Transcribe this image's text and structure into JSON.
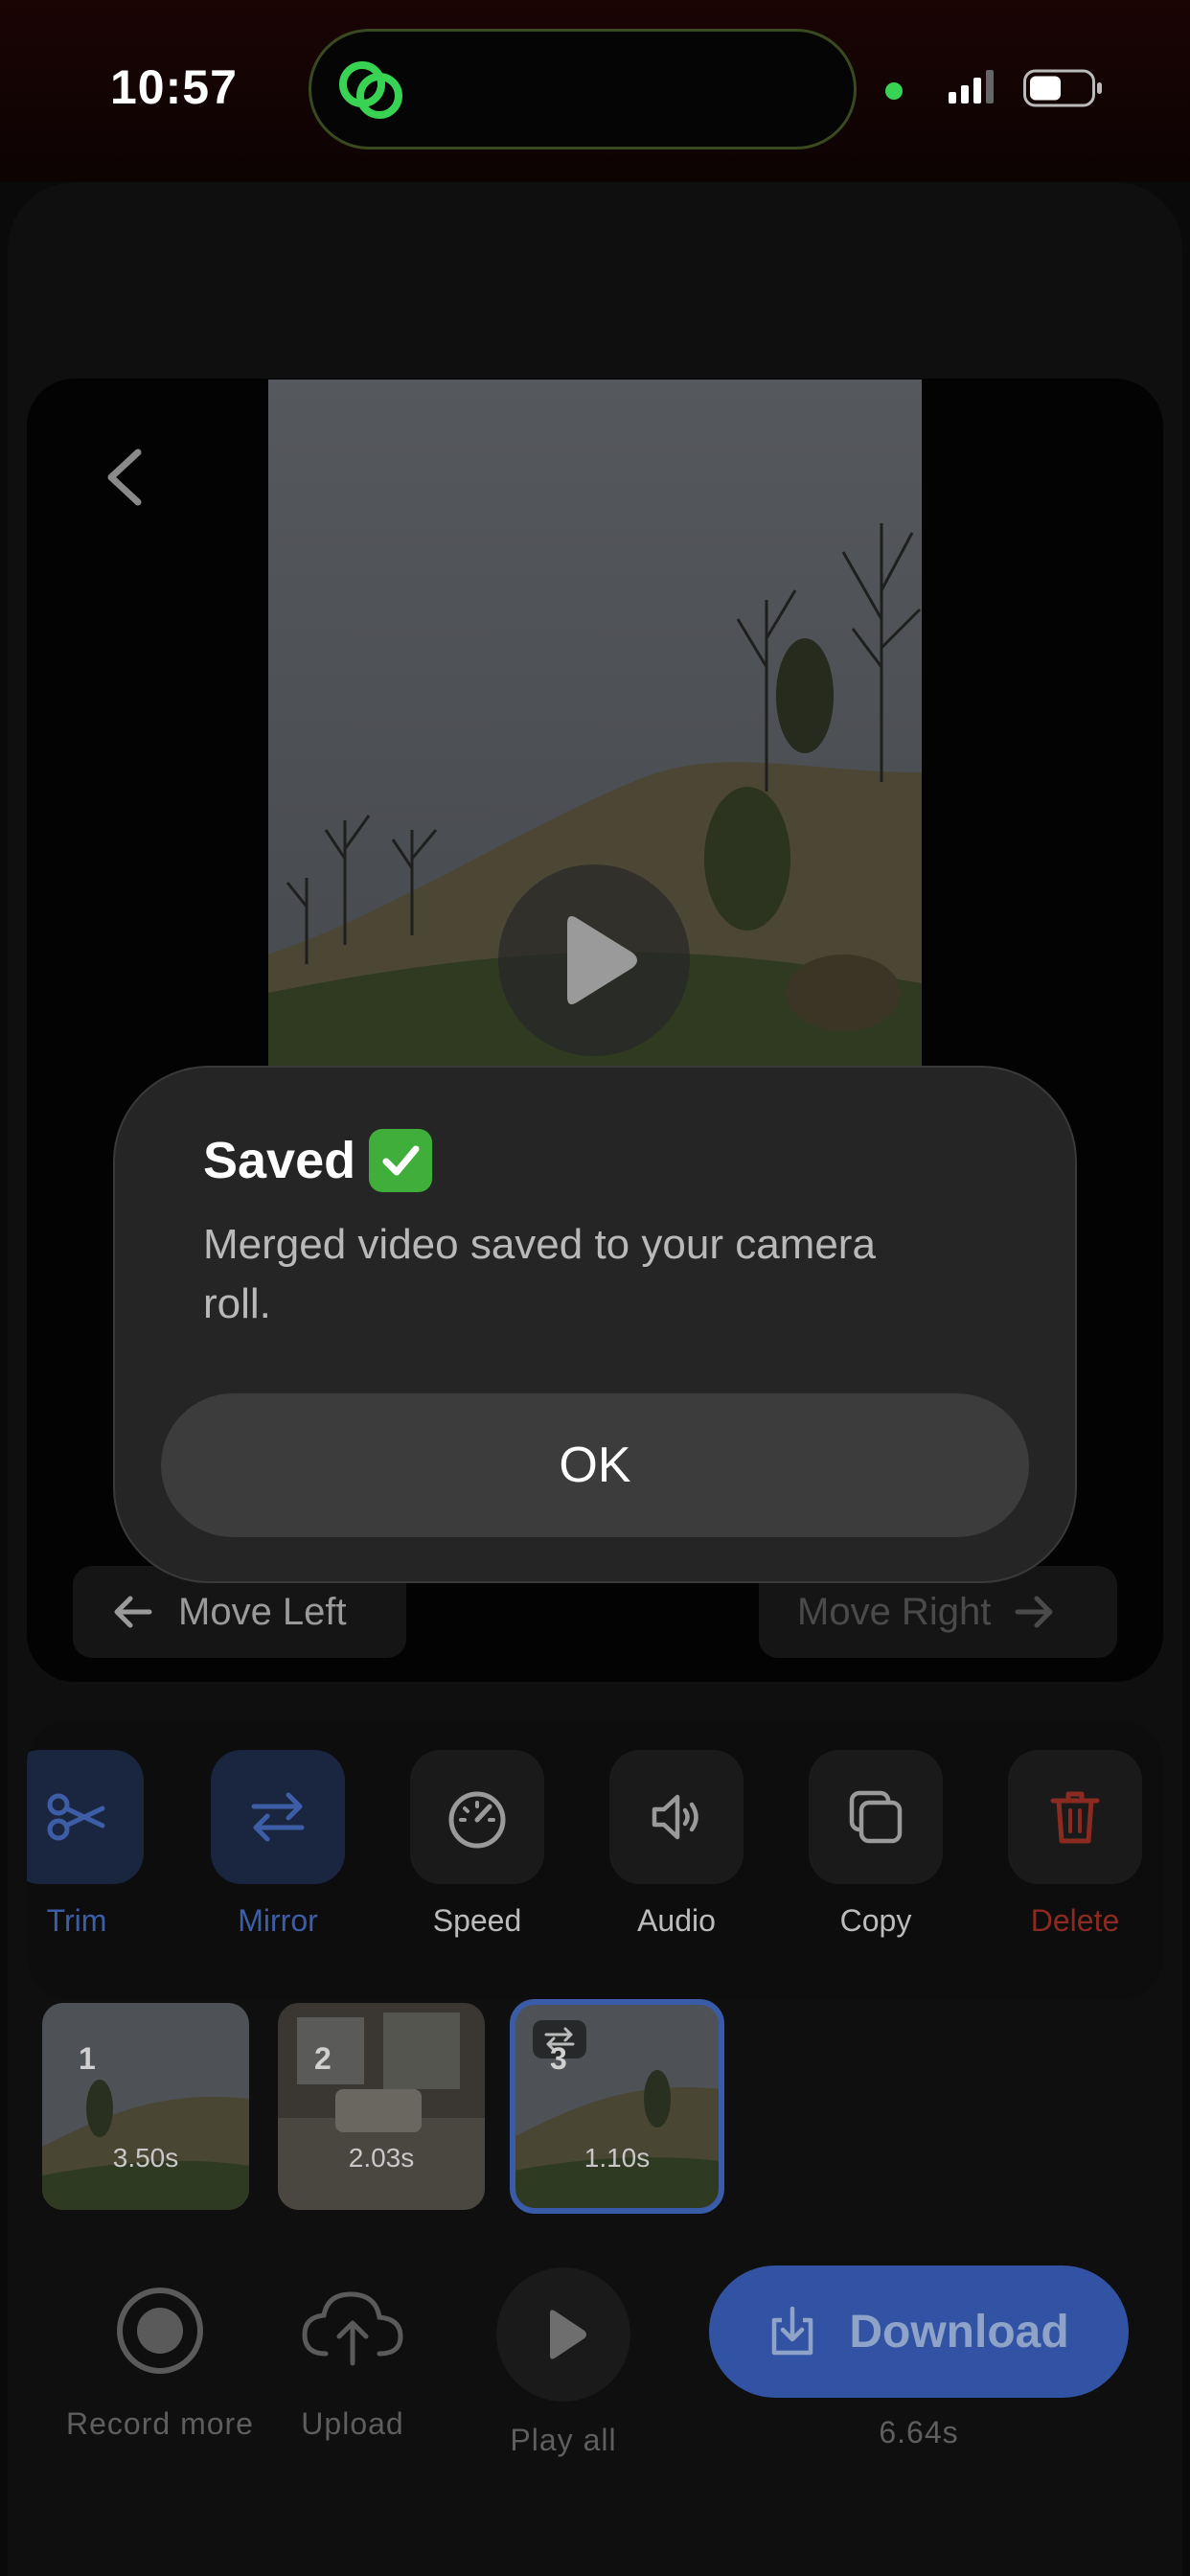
{
  "status_bar": {
    "time": "10:57"
  },
  "editor": {
    "move_left_label": "Move Left",
    "move_right_label": "Move Right"
  },
  "tools": [
    {
      "label": "Trim",
      "icon": "scissors-icon",
      "state": "active"
    },
    {
      "label": "Mirror",
      "icon": "swap-arrows-icon",
      "state": "active"
    },
    {
      "label": "Speed",
      "icon": "speedometer-icon",
      "state": "normal"
    },
    {
      "label": "Audio",
      "icon": "speaker-icon",
      "state": "normal"
    },
    {
      "label": "Copy",
      "icon": "copy-icon",
      "state": "normal"
    },
    {
      "label": "Delete",
      "icon": "trash-icon",
      "state": "danger"
    }
  ],
  "clips": [
    {
      "number": "1",
      "duration": "3.50s",
      "selected": false
    },
    {
      "number": "2",
      "duration": "2.03s",
      "selected": false
    },
    {
      "number": "3",
      "duration": "1.10s",
      "selected": true
    }
  ],
  "bottom_bar": {
    "record_label": "Record more",
    "upload_label": "Upload",
    "play_all_label": "Play all",
    "download_label": "Download",
    "total_duration": "6.64s"
  },
  "alert": {
    "title": "Saved",
    "message": "Merged video saved to your camera roll.",
    "ok_label": "OK"
  },
  "colors": {
    "accent": "#3253a4",
    "active_tool": "#3d5ea6",
    "danger": "#8a2a20",
    "status_dot": "#39d353"
  }
}
